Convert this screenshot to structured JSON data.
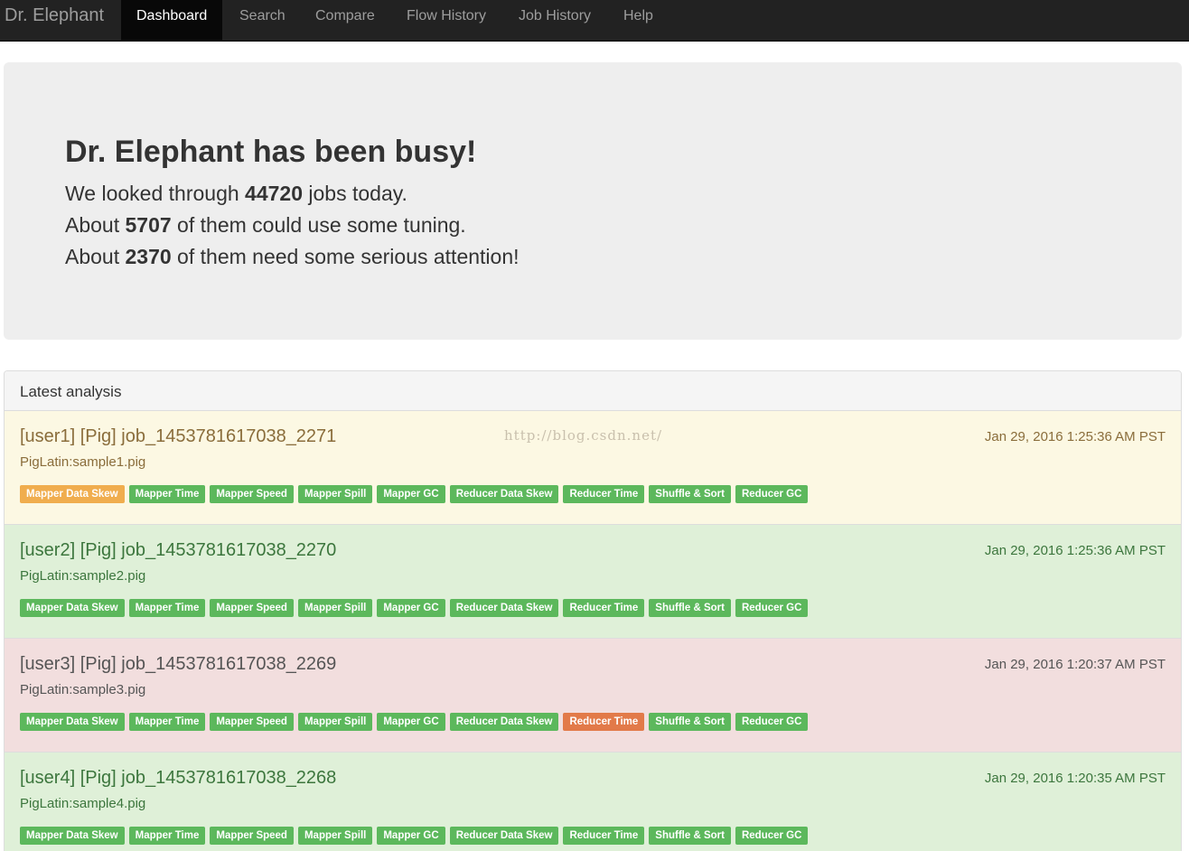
{
  "navbar": {
    "brand": "Dr. Elephant",
    "items": [
      {
        "label": "Dashboard",
        "active": true
      },
      {
        "label": "Search"
      },
      {
        "label": "Compare"
      },
      {
        "label": "Flow History"
      },
      {
        "label": "Job History"
      },
      {
        "label": "Help"
      }
    ]
  },
  "summary": {
    "title": "Dr. Elephant has been busy!",
    "line1_pre": "We looked through ",
    "line1_num": "44720",
    "line1_post": " jobs today.",
    "line2_pre": "About ",
    "line2_num": "5707",
    "line2_post": " of them could use some tuning.",
    "line3_pre": "About ",
    "line3_num": "2370",
    "line3_post": " of them need some serious attention!"
  },
  "panel": {
    "title": "Latest analysis",
    "watermark": "http://blog.csdn.net/",
    "jobs": [
      {
        "title": "[user1] [Pig] job_1453781617038_2271",
        "name": "PigLatin:sample1.pig",
        "time": "Jan 29, 2016 1:25:36 AM PST",
        "severity": "warning",
        "heuristics": [
          "Mapper Data Skew",
          "Mapper Time",
          "Mapper Speed",
          "Mapper Spill",
          "Mapper GC",
          "Reducer Data Skew",
          "Reducer Time",
          "Shuffle & Sort",
          "Reducer GC"
        ]
      },
      {
        "title": "[user2] [Pig] job_1453781617038_2270",
        "name": "PigLatin:sample2.pig",
        "time": "Jan 29, 2016 1:25:36 AM PST",
        "severity": "ok",
        "heuristics": [
          "Mapper Data Skew",
          "Mapper Time",
          "Mapper Speed",
          "Mapper Spill",
          "Mapper GC",
          "Reducer Data Skew",
          "Reducer Time",
          "Shuffle & Sort",
          "Reducer GC"
        ]
      },
      {
        "title": "[user3] [Pig] job_1453781617038_2269",
        "name": "PigLatin:sample3.pig",
        "time": "Jan 29, 2016 1:20:37 AM PST",
        "severity": "danger",
        "heuristics": [
          "Mapper Data Skew",
          "Mapper Time",
          "Mapper Speed",
          "Mapper Spill",
          "Mapper GC",
          "Reducer Data Skew",
          "Reducer Time",
          "Shuffle & Sort",
          "Reducer GC"
        ]
      },
      {
        "title": "[user4] [Pig] job_1453781617038_2268",
        "name": "PigLatin:sample4.pig",
        "time": "Jan 29, 2016 1:20:35 AM PST",
        "severity": "ok",
        "heuristics": [
          "Mapper Data Skew",
          "Mapper Time",
          "Mapper Speed",
          "Mapper Spill",
          "Mapper GC",
          "Reducer Data Skew",
          "Reducer Time",
          "Shuffle & Sort",
          "Reducer GC"
        ]
      }
    ]
  },
  "colors": {
    "severity_none": "#5cb85c",
    "severity_moderate": "#f0ad4e",
    "severity_severe": "#e27a49",
    "row_warning": "#fcf8e3",
    "row_ok": "#dff0d8",
    "row_danger": "#f2dede"
  }
}
